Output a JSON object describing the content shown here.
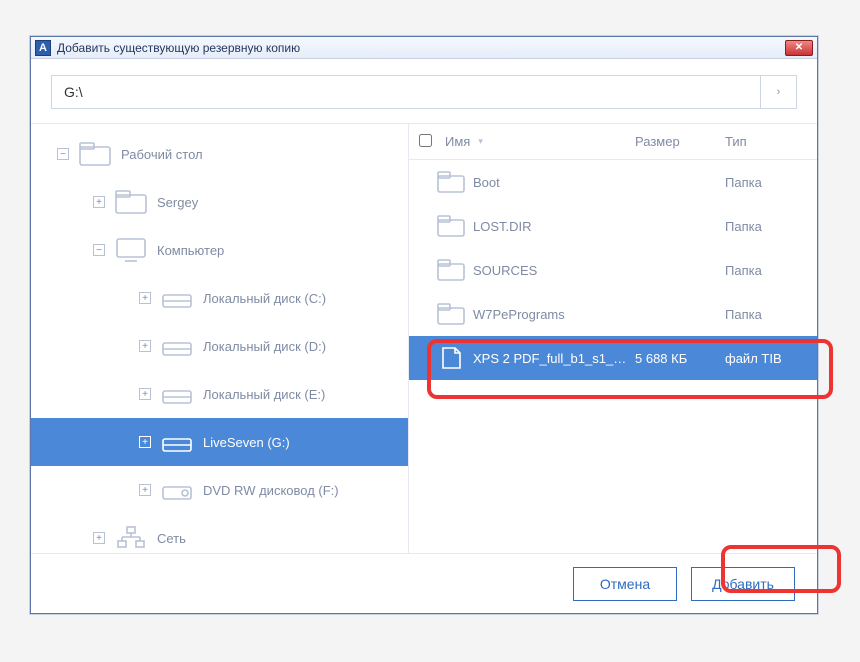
{
  "window": {
    "app_glyph": "A",
    "title": "Добавить существующую резервную копию",
    "close_glyph": "✕"
  },
  "path": {
    "value": "G:\\",
    "go_glyph": "›"
  },
  "tree": {
    "desktop": {
      "label": "Рабочий стол"
    },
    "user": {
      "label": "Sergey"
    },
    "computer": {
      "label": "Компьютер"
    },
    "drive_c": {
      "label": "Локальный диск (C:)"
    },
    "drive_d": {
      "label": "Локальный диск (D:)"
    },
    "drive_e": {
      "label": "Локальный диск (E:)"
    },
    "drive_g": {
      "label": "LiveSeven (G:)"
    },
    "dvd": {
      "label": "DVD RW дисковод (F:)"
    },
    "network": {
      "label": "Сеть"
    }
  },
  "columns": {
    "name": "Имя",
    "size": "Размер",
    "type": "Тип",
    "sort_glyph": "▾"
  },
  "files": [
    {
      "name": "Boot",
      "size": "",
      "type": "Папка",
      "kind": "folder",
      "selected": false
    },
    {
      "name": "LOST.DIR",
      "size": "",
      "type": "Папка",
      "kind": "folder",
      "selected": false
    },
    {
      "name": "SOURCES",
      "size": "",
      "type": "Папка",
      "kind": "folder",
      "selected": false
    },
    {
      "name": "W7PePrograms",
      "size": "",
      "type": "Папка",
      "kind": "folder",
      "selected": false
    },
    {
      "name": "XPS 2 PDF_full_b1_s1_…",
      "size": "5 688 КБ",
      "type": "файл TIB",
      "kind": "file",
      "selected": true
    }
  ],
  "footer": {
    "cancel": "Отмена",
    "add": "Добавить"
  }
}
